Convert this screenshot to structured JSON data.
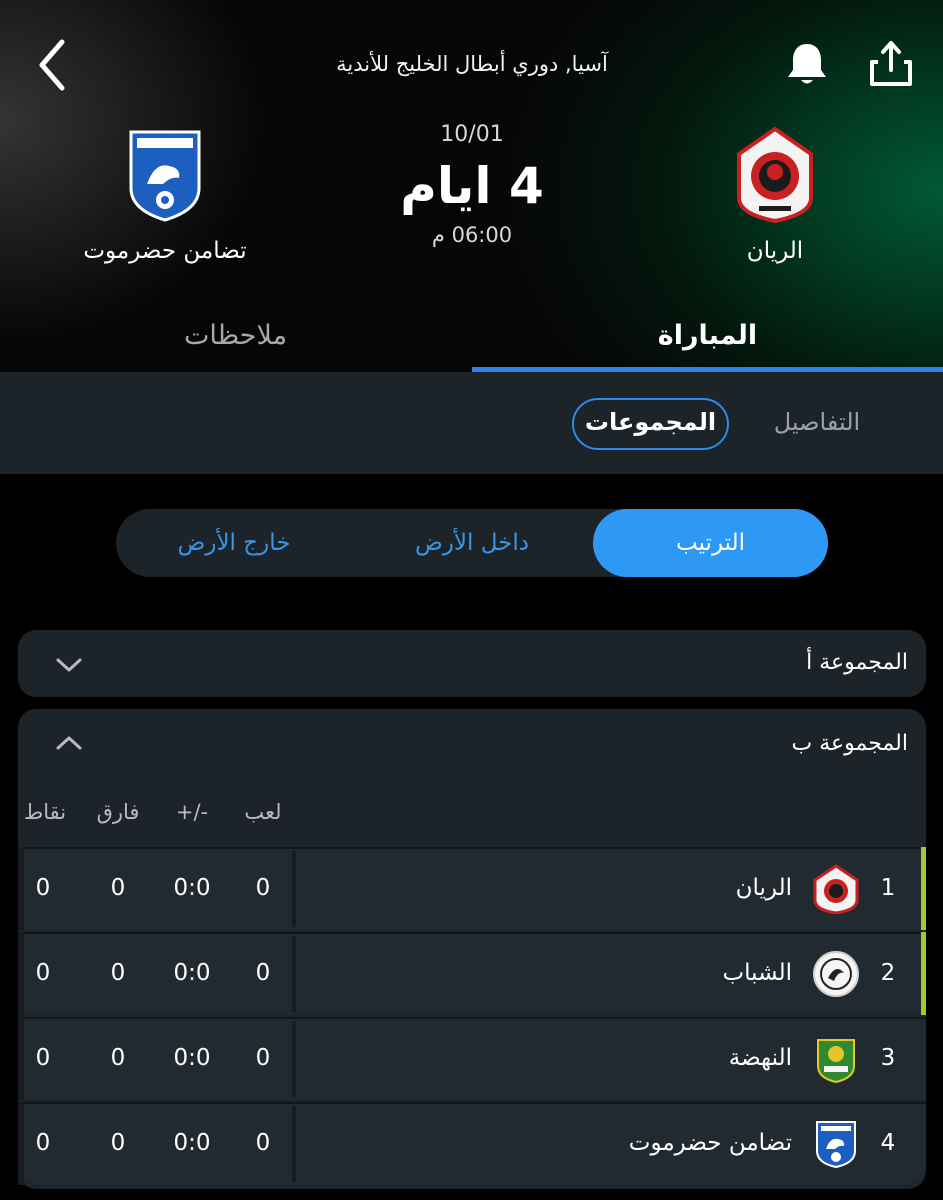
{
  "header": {
    "competition": "آسيا, دوري أبطال الخليج للأندية",
    "home_team": "الريان",
    "away_team": "تضامن حضرموت",
    "date": "10/01",
    "countdown": "4 ايام",
    "time": "06:00 م"
  },
  "tabs": {
    "match": "المباراة",
    "notes": "ملاحظات"
  },
  "subtabs": {
    "details": "التفاصيل",
    "groups": "المجموعات"
  },
  "segment": {
    "ranking": "الترتيب",
    "home": "داخل الأرض",
    "away": "خارج الأرض"
  },
  "group_a": {
    "title": "المجموعة أ"
  },
  "group_b": {
    "title": "المجموعة ب",
    "columns": {
      "played": "لعب",
      "goals": "+/-",
      "diff": "فارق",
      "points": "نقاط"
    },
    "rows": [
      {
        "pos": "1",
        "team": "الريان",
        "played": "0",
        "goals": "0:0",
        "diff": "0",
        "points": "0"
      },
      {
        "pos": "2",
        "team": "الشباب",
        "played": "0",
        "goals": "0:0",
        "diff": "0",
        "points": "0"
      },
      {
        "pos": "3",
        "team": "النهضة",
        "played": "0",
        "goals": "0:0",
        "diff": "0",
        "points": "0"
      },
      {
        "pos": "4",
        "team": "تضامن حضرموت",
        "played": "0",
        "goals": "0:0",
        "diff": "0",
        "points": "0"
      }
    ]
  },
  "colors": {
    "accent": "#2f7fe4",
    "segment_active": "#2d99f4",
    "qualify_marker": "#9ccc34",
    "card_bg": "#1c2329"
  },
  "icons": {
    "back": "chevron-left-icon",
    "bell": "bell-icon",
    "share": "share-icon"
  }
}
